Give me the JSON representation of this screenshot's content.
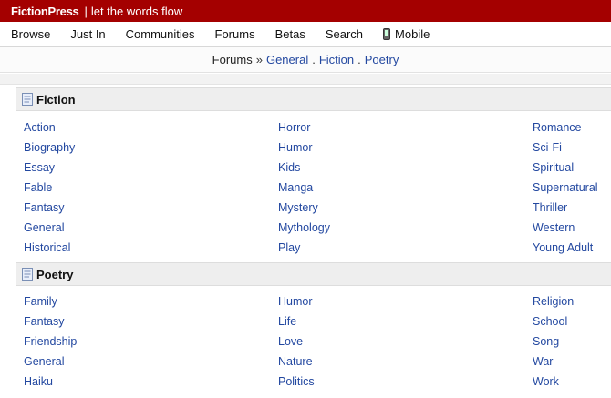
{
  "header": {
    "brand": "FictionPress",
    "separator": "|",
    "tagline": "let the words flow"
  },
  "nav": {
    "items": [
      "Browse",
      "Just In",
      "Communities",
      "Forums",
      "Betas",
      "Search"
    ],
    "mobile_label": "Mobile",
    "mobile_icon": "mobile-phone-icon"
  },
  "breadcrumb": {
    "root": "Forums",
    "arrow": "»",
    "links": [
      "General",
      "Fiction",
      "Poetry"
    ],
    "dot": "."
  },
  "sections": [
    {
      "title": "Fiction",
      "icon": "document-icon",
      "columns": [
        [
          "Action",
          "Biography",
          "Essay",
          "Fable",
          "Fantasy",
          "General",
          "Historical"
        ],
        [
          "Horror",
          "Humor",
          "Kids",
          "Manga",
          "Mystery",
          "Mythology",
          "Play"
        ],
        [
          "Romance",
          "Sci-Fi",
          "Spiritual",
          "Supernatural",
          "Thriller",
          "Western",
          "Young Adult"
        ]
      ]
    },
    {
      "title": "Poetry",
      "icon": "document-icon",
      "columns": [
        [
          "Family",
          "Fantasy",
          "Friendship",
          "General",
          "Haiku"
        ],
        [
          "Humor",
          "Life",
          "Love",
          "Nature",
          "Politics"
        ],
        [
          "Religion",
          "School",
          "Song",
          "War",
          "Work"
        ]
      ]
    }
  ],
  "colors": {
    "header_bg": "#a40000",
    "link": "#2348a0"
  }
}
